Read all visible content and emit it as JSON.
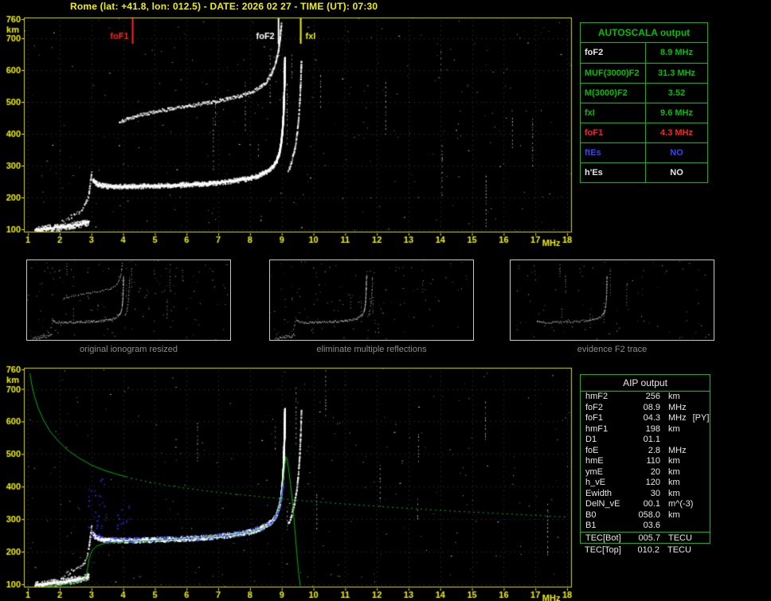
{
  "header": {
    "title": "Rome (lat: +41.8, lon: 012.5) - DATE: 2026 02 27 - TIME (UT): 07:30",
    "station": "Rome",
    "lat": "+41.8",
    "lon": "012.5",
    "date": "2026 02 27",
    "time_ut": "07:30"
  },
  "colors": {
    "accent_yellow": "#f0f000",
    "border_yellow": "#d8d800",
    "table_green": "#00c000",
    "profile_green": "#00b400",
    "grid_blue": "#333d47",
    "marker_red": "#ff2222",
    "value_blue": "#3344ff",
    "text_white": "#e8e8e8",
    "caption_gray": "#8c8c8c",
    "trace_blue": "#2a30ff",
    "trace_white": "#ffffff"
  },
  "autoscala": {
    "title": "AUTOSCALA output",
    "rows": [
      {
        "key": "foF2",
        "label": "foF2",
        "value": "8.9 MHz",
        "label_color": "#e8e8e8",
        "value_color": "#00c000"
      },
      {
        "key": "MUF3000F2",
        "label": "MUF(3000)F2",
        "value": "31.3 MHz",
        "label_color": "#00c000",
        "value_color": "#00c000"
      },
      {
        "key": "M3000F2",
        "label": "M(3000)F2",
        "value": "3.52",
        "label_color": "#00c000",
        "value_color": "#00c000"
      },
      {
        "key": "fxI",
        "label": "fxI",
        "value": "9.6 MHz",
        "label_color": "#00c000",
        "value_color": "#00c000"
      },
      {
        "key": "foF1",
        "label": "foF1",
        "value": "4.3 MHz",
        "label_color": "#ff2222",
        "value_color": "#ff2222"
      },
      {
        "key": "ftEs",
        "label": "ftEs",
        "value": "NO",
        "label_color": "#3344ff",
        "value_color": "#3344ff"
      },
      {
        "key": "hEs",
        "label": "h'Es",
        "value": "NO",
        "label_color": "#e8e8e8",
        "value_color": "#e8e8e8"
      }
    ]
  },
  "aip": {
    "title": "AIP output",
    "rows": [
      {
        "key": "hmF2",
        "name": "hmF2",
        "value": "256",
        "unit": "km",
        "extra": ""
      },
      {
        "key": "foF2",
        "name": "foF2",
        "value": "08.9",
        "unit": "MHz",
        "extra": ""
      },
      {
        "key": "foF1",
        "name": "foF1",
        "value": "04.3",
        "unit": "MHz",
        "extra": "[PY]"
      },
      {
        "key": "hmF1",
        "name": "hmF1",
        "value": "198",
        "unit": "km",
        "extra": ""
      },
      {
        "key": "D1",
        "name": "D1",
        "value": "01.1",
        "unit": "",
        "extra": ""
      },
      {
        "key": "foE",
        "name": "foE",
        "value": "2.8",
        "unit": "MHz",
        "extra": ""
      },
      {
        "key": "hmE",
        "name": "hmE",
        "value": "110",
        "unit": "km",
        "extra": ""
      },
      {
        "key": "ymE",
        "name": "ymE",
        "value": "20",
        "unit": "km",
        "extra": ""
      },
      {
        "key": "h_vE",
        "name": "h_vE",
        "value": "120",
        "unit": "km",
        "extra": ""
      },
      {
        "key": "Ewidth",
        "name": "Ewidth",
        "value": "30",
        "unit": "km",
        "extra": ""
      },
      {
        "key": "DelN_vE",
        "name": "DelN_vE",
        "value": "00.1",
        "unit": "m^(-3)",
        "extra": ""
      },
      {
        "key": "B0",
        "name": "B0",
        "value": "058.0",
        "unit": "km",
        "extra": ""
      },
      {
        "key": "B1",
        "name": "B1",
        "value": "03.6",
        "unit": "",
        "extra": ""
      }
    ],
    "tec_bot": {
      "name": "TEC[Bot]",
      "value": "005.7",
      "unit": "TECU"
    },
    "tec_top": {
      "name": "TEC[Top]",
      "value": "010.2",
      "unit": "TECU"
    }
  },
  "chart_data": {
    "type": "scatter",
    "description": "vertical incidence ionogram, virtual height (km) vs frequency (MHz)",
    "x_unit": "MHz",
    "y_unit": "km",
    "xlim": [
      1,
      18
    ],
    "ylim": [
      100,
      760
    ],
    "x_ticks": [
      1,
      2,
      3,
      4,
      5,
      6,
      7,
      8,
      9,
      10,
      11,
      12,
      13,
      14,
      15,
      16,
      17,
      18
    ],
    "y_ticks": [
      760,
      700,
      600,
      500,
      400,
      300,
      200,
      100
    ],
    "y_grid": [
      100,
      200,
      300,
      400,
      500,
      600,
      700
    ],
    "trace_library": {
      "E": {
        "points": [
          [
            1.2,
            99
          ],
          [
            1.45,
            102
          ],
          [
            1.7,
            105
          ],
          [
            2.0,
            109
          ],
          [
            2.3,
            113
          ],
          [
            2.55,
            117
          ],
          [
            2.75,
            121
          ],
          [
            2.9,
            126
          ]
        ],
        "thickness": 9,
        "density": 2.4,
        "size": 2,
        "core": true
      },
      "E_upper": {
        "points": [
          [
            2.05,
            130
          ],
          [
            2.35,
            141
          ],
          [
            2.6,
            154
          ],
          [
            2.75,
            170
          ],
          [
            2.85,
            192
          ],
          [
            2.9,
            213
          ]
        ],
        "thickness": 6,
        "density": 0.5,
        "size": 2
      },
      "retard": {
        "points": [
          [
            2.9,
            213
          ],
          [
            2.93,
            238
          ],
          [
            2.96,
            260
          ],
          [
            2.99,
            280
          ]
        ],
        "thickness": 6,
        "density": 0.7,
        "size": 2
      },
      "F": {
        "points": [
          [
            3.02,
            258
          ],
          [
            3.1,
            247
          ],
          [
            3.25,
            241
          ],
          [
            3.45,
            238
          ],
          [
            3.7,
            236
          ],
          [
            4.0,
            236
          ],
          [
            4.4,
            237
          ],
          [
            4.8,
            238
          ],
          [
            5.2,
            239
          ],
          [
            5.6,
            240
          ],
          [
            6.0,
            242
          ],
          [
            6.4,
            244
          ],
          [
            6.8,
            247
          ],
          [
            7.2,
            251
          ],
          [
            7.6,
            256
          ],
          [
            7.95,
            262
          ],
          [
            8.25,
            271
          ],
          [
            8.5,
            283
          ],
          [
            8.7,
            298
          ],
          [
            8.82,
            316
          ],
          [
            8.9,
            340
          ],
          [
            8.96,
            372
          ],
          [
            9.0,
            410
          ],
          [
            9.03,
            455
          ],
          [
            9.05,
            510
          ],
          [
            9.07,
            575
          ],
          [
            9.08,
            640
          ]
        ],
        "thickness": 6,
        "density": 2.6,
        "size": 2,
        "core": true
      },
      "X_tail": {
        "points": [
          [
            9.18,
            285
          ],
          [
            9.28,
            310
          ],
          [
            9.37,
            345
          ],
          [
            9.45,
            390
          ],
          [
            9.51,
            445
          ],
          [
            9.55,
            505
          ],
          [
            9.58,
            570
          ],
          [
            9.6,
            635
          ]
        ],
        "thickness": 4,
        "density": 0.8,
        "size": 2
      },
      "second_order": {
        "points": [
          [
            3.85,
            438
          ],
          [
            4.2,
            452
          ],
          [
            4.6,
            463
          ],
          [
            5.0,
            472
          ],
          [
            5.4,
            479
          ],
          [
            5.8,
            486
          ],
          [
            6.2,
            492
          ],
          [
            6.6,
            499
          ],
          [
            7.0,
            506
          ],
          [
            7.4,
            514
          ],
          [
            7.75,
            523
          ],
          [
            8.05,
            534
          ],
          [
            8.3,
            548
          ],
          [
            8.5,
            566
          ],
          [
            8.65,
            590
          ],
          [
            8.78,
            622
          ],
          [
            8.87,
            660
          ],
          [
            8.93,
            705
          ],
          [
            8.97,
            748
          ]
        ],
        "thickness": 4,
        "density": 1.2,
        "size": 2
      }
    },
    "ionogram_top": {
      "noise": {
        "speckles": 260,
        "columns": 14,
        "seed": 42
      },
      "traces": [
        "E",
        "E_upper",
        "retard",
        "F",
        "X_tail",
        "second_order"
      ],
      "markers": [
        {
          "label": "foF1",
          "freq": 4.3,
          "color": "#ff2222",
          "side": "left"
        },
        {
          "label": "foF2",
          "freq": 8.9,
          "color": "#ffffff",
          "side": "left"
        },
        {
          "label": "fxI",
          "freq": 9.6,
          "color": "#f0f000",
          "side": "right"
        }
      ]
    },
    "ionogram_bottom": {
      "noise": {
        "speckles": 230,
        "columns": 11,
        "seed": 77
      },
      "traces": [
        "E",
        "E_upper",
        "retard",
        "F",
        "X_tail"
      ],
      "profiles": [
        {
          "name": "topside-profile",
          "style": "solid",
          "points": [
            [
              1.06,
              748
            ],
            [
              1.12,
              712
            ],
            [
              1.2,
              678
            ],
            [
              1.32,
              642
            ],
            [
              1.48,
              606
            ],
            [
              1.68,
              572
            ],
            [
              1.95,
              540
            ],
            [
              2.25,
              512
            ],
            [
              2.6,
              488
            ],
            [
              3.0,
              466
            ],
            [
              3.4,
              450
            ],
            [
              3.8,
              438
            ],
            [
              4.1,
              430
            ]
          ]
        },
        {
          "name": "topside-extrapolation",
          "style": "dotted",
          "points": [
            [
              4.1,
              430
            ],
            [
              4.8,
              414
            ],
            [
              5.6,
              400
            ],
            [
              6.5,
              388
            ],
            [
              7.5,
              377
            ],
            [
              8.5,
              367
            ],
            [
              9.5,
              358
            ],
            [
              10.5,
              350
            ],
            [
              11.5,
              343
            ],
            [
              12.5,
              336
            ],
            [
              13.5,
              330
            ],
            [
              14.5,
              324
            ],
            [
              15.5,
              319
            ],
            [
              16.5,
              314
            ],
            [
              17.5,
              309
            ],
            [
              17.95,
              306
            ]
          ]
        },
        {
          "name": "bottomside-profile",
          "style": "solid",
          "points": [
            [
              1.5,
              92
            ],
            [
              1.9,
              96
            ],
            [
              2.3,
              101
            ],
            [
              2.6,
              107
            ],
            [
              2.75,
              114
            ],
            [
              2.83,
              124
            ],
            [
              2.88,
              150
            ],
            [
              2.93,
              180
            ],
            [
              3.03,
              205
            ],
            [
              3.18,
              218
            ],
            [
              3.4,
              225
            ],
            [
              3.7,
              228
            ],
            [
              4.0,
              230
            ],
            [
              4.4,
              232
            ],
            [
              4.9,
              234
            ],
            [
              5.4,
              237
            ],
            [
              5.9,
              240
            ],
            [
              6.4,
              243
            ],
            [
              6.9,
              246
            ],
            [
              7.3,
              250
            ],
            [
              7.7,
              255
            ],
            [
              8.05,
              261
            ],
            [
              8.35,
              270
            ],
            [
              8.6,
              283
            ],
            [
              8.75,
              299
            ],
            [
              8.87,
              321
            ],
            [
              8.95,
              350
            ],
            [
              9.01,
              385
            ],
            [
              9.06,
              425
            ],
            [
              9.1,
              465
            ],
            [
              9.13,
              492
            ],
            [
              9.17,
              487
            ],
            [
              9.22,
              452
            ],
            [
              9.28,
              407
            ],
            [
              9.34,
              352
            ],
            [
              9.39,
              298
            ],
            [
              9.43,
              250
            ],
            [
              9.47,
              203
            ],
            [
              9.51,
              158
            ],
            [
              9.55,
              120
            ],
            [
              9.59,
              94
            ]
          ]
        }
      ],
      "blue_trace": {
        "seed": 5,
        "points": [
          [
            3.0,
            252
          ],
          [
            3.15,
            244
          ],
          [
            3.3,
            240
          ],
          [
            3.5,
            238
          ],
          [
            3.8,
            237
          ],
          [
            4.1,
            237
          ],
          [
            4.5,
            238
          ],
          [
            4.9,
            239
          ],
          [
            5.3,
            240
          ],
          [
            5.7,
            241
          ],
          [
            6.1,
            243
          ],
          [
            6.5,
            245
          ],
          [
            6.9,
            248
          ],
          [
            7.3,
            252
          ],
          [
            7.7,
            257
          ],
          [
            8.0,
            263
          ],
          [
            8.3,
            272
          ],
          [
            8.55,
            285
          ],
          [
            8.72,
            300
          ],
          [
            8.85,
            322
          ],
          [
            8.95,
            350
          ],
          [
            9.0,
            385
          ],
          [
            9.05,
            420
          ]
        ],
        "clusters": [
          {
            "f": [
              2.88,
              3.45
            ],
            "h": [
              250,
              430
            ],
            "count": 30
          },
          {
            "f": [
              3.8,
              4.2
            ],
            "h": [
              260,
              345
            ],
            "count": 12
          }
        ]
      }
    },
    "thumbnails": [
      {
        "caption": "original ionogram resized",
        "traces": [
          "E",
          "E_upper",
          "retard",
          "F",
          "X_tail",
          "second_order"
        ],
        "speckles": 150,
        "columns": 7,
        "seed": 11,
        "density_scale": 0.55
      },
      {
        "caption": "eliminate multiple reflections",
        "traces": [
          "E",
          "E_upper",
          "retard",
          "F",
          "X_tail"
        ],
        "speckles": 120,
        "columns": 5,
        "seed": 12,
        "density_scale": 0.55
      },
      {
        "caption": "evidence F2 trace",
        "traces": [
          "F"
        ],
        "speckles": 90,
        "columns": 8,
        "seed": 13,
        "density_scale": 0.4
      }
    ]
  }
}
